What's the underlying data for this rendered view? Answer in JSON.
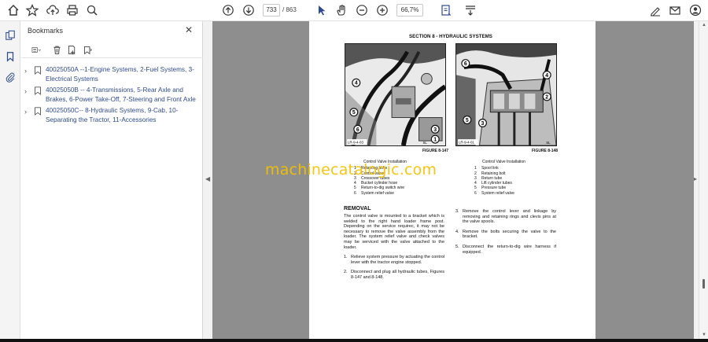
{
  "toolbar": {
    "page_current": "733",
    "page_total": "/ 863",
    "zoom": "66,7%"
  },
  "left_strip": {
    "icons": [
      "pages-icon",
      "bookmark-icon",
      "attachment-icon"
    ]
  },
  "bookmarks": {
    "title": "Bookmarks",
    "close_symbol": "✕",
    "items": [
      {
        "label": "40025050A --1-Engine Systems,  2-Fuel Systems, 3-Electrical Systems"
      },
      {
        "label": "40025050B -- 4-Transmissions, 5-Rear Axle and Brakes, 6-Power Take-Off, 7-Steering and Front Axle"
      },
      {
        "label": "40025050C-- 8-Hydraulic Systems, 9-Cab, 10-Separating the Tractor, 11-Accessories"
      }
    ]
  },
  "document": {
    "header": "SECTION 8 - HYDRAULIC SYSTEMS",
    "fig1": {
      "caption": "FIGURE 8-147",
      "code": "LR-9-4-03",
      "corner": "SL",
      "callouts": [
        "4",
        "5",
        "6",
        "3",
        "1"
      ]
    },
    "fig2": {
      "caption": "FIGURE 8-148",
      "code": "LR-9-4-01",
      "corner": "SL",
      "callouts": [
        "6",
        "4",
        "2",
        "5",
        "3"
      ]
    },
    "legend1": {
      "title": "Control Valve Installation",
      "items": [
        {
          "n": "1",
          "t": "Retaining bolts"
        },
        {
          "n": "2",
          "t": "Control valve"
        },
        {
          "n": "3",
          "t": "Crossover tubes"
        },
        {
          "n": "4",
          "t": "Bucket cylinder hose"
        },
        {
          "n": "5",
          "t": "Return-to-dig switch wire"
        },
        {
          "n": "6",
          "t": "System relief valve"
        }
      ]
    },
    "legend2": {
      "title": "Control Valve Installation",
      "items": [
        {
          "n": "1",
          "t": "Spool link"
        },
        {
          "n": "2",
          "t": "Retaining bolt"
        },
        {
          "n": "3",
          "t": "Return tube"
        },
        {
          "n": "4",
          "t": "Lift cylinder tubes"
        },
        {
          "n": "5",
          "t": "Pressure tube"
        },
        {
          "n": "6",
          "t": "System relief valve"
        }
      ]
    },
    "removal_heading": "REMOVAL",
    "removal_intro": "The control valve is mounted to a bracket which is welded to the right hand loader frame post.  Depending on the service requirec, it may not be necessary to remove the valve assembly from the loader.  The system relief valve and check valves may be serviced with the valve attached to the loader.",
    "steps_left": [
      {
        "n": "1.",
        "t": "Relieve system pressure by actuating the control lever with the tractor engine stopped."
      },
      {
        "n": "2.",
        "t": "Disconnect and plug all hydraulic tubes, Figures 8-147 and 8-148."
      }
    ],
    "steps_right": [
      {
        "n": "3.",
        "t": "Remove the control lever and linkage by removing and retaining rings and clevis pins at the valve spools."
      },
      {
        "n": "4.",
        "t": "Remove the bolts securing the valve to the bracket."
      },
      {
        "n": "5.",
        "t": "Disconnect the return-to-dig wire harness if equipped."
      }
    ]
  },
  "watermark": "machinecatalogic.com",
  "colors": {
    "accent": "#2f4b8f",
    "doc_bg": "#8e8e8e",
    "watermark": "#f2c200"
  }
}
